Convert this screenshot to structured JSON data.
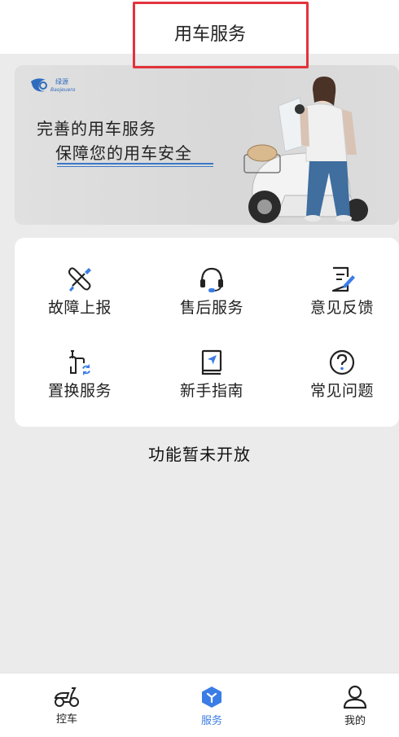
{
  "header": {
    "title": "用车服务"
  },
  "banner": {
    "brand_name": "绿源",
    "brand_en": "Baojeuero",
    "line1": "完善的用车服务",
    "line2": "保障您的用车安全"
  },
  "services": [
    {
      "label": "故障上报",
      "icon": "wrench-screwdriver-icon"
    },
    {
      "label": "售后服务",
      "icon": "headset-icon"
    },
    {
      "label": "意见反馈",
      "icon": "note-pencil-icon"
    },
    {
      "label": "置换服务",
      "icon": "scooter-swap-icon"
    },
    {
      "label": "新手指南",
      "icon": "guide-book-icon"
    },
    {
      "label": "常见问题",
      "icon": "question-circle-icon"
    }
  ],
  "notice": "功能暂未开放",
  "tabbar": {
    "items": [
      {
        "label": "控车",
        "icon": "scooter-icon",
        "active": false
      },
      {
        "label": "服务",
        "icon": "service-hexagon-icon",
        "active": true
      },
      {
        "label": "我的",
        "icon": "person-icon",
        "active": false
      }
    ]
  },
  "colors": {
    "accent": "#3b7de6",
    "highlight_border": "#e3333c",
    "background": "#ebebeb"
  }
}
